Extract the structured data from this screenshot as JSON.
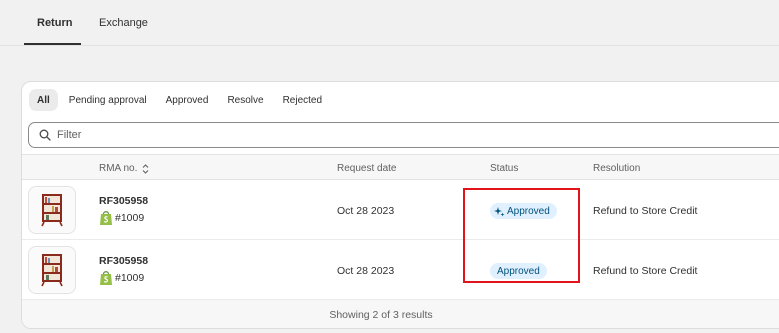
{
  "top_tabs": [
    {
      "label": "Return",
      "active": true
    },
    {
      "label": "Exchange",
      "active": false
    }
  ],
  "filter_tabs": [
    {
      "label": "All",
      "active": true
    },
    {
      "label": "Pending approval",
      "active": false
    },
    {
      "label": "Approved",
      "active": false
    },
    {
      "label": "Resolve",
      "active": false
    },
    {
      "label": "Rejected",
      "active": false
    }
  ],
  "filter": {
    "placeholder": "Filter",
    "value": ""
  },
  "table": {
    "headers": {
      "rma": "RMA no.",
      "request_date": "Request date",
      "status": "Status",
      "resolution": "Resolution"
    },
    "rows": [
      {
        "rma_no": "RF305958",
        "order": "#1009",
        "request_date": "Oct 28 2023",
        "status": "Approved",
        "status_icon": "sparkle-icon",
        "resolution": "Refund to Store Credit",
        "thumbnail": "bookshelf-image"
      },
      {
        "rma_no": "RF305958",
        "order": "#1009",
        "request_date": "Oct 28 2023",
        "status": "Approved",
        "status_icon": null,
        "resolution": "Refund to Store Credit",
        "thumbnail": "bookshelf-image"
      }
    ]
  },
  "footer": {
    "text": "Showing 2 of 3 results"
  },
  "colors": {
    "badge_bg": "#e0f0ff",
    "badge_text": "#00527c",
    "highlight": "#e0141a",
    "shopify_green": "#95bf47"
  }
}
